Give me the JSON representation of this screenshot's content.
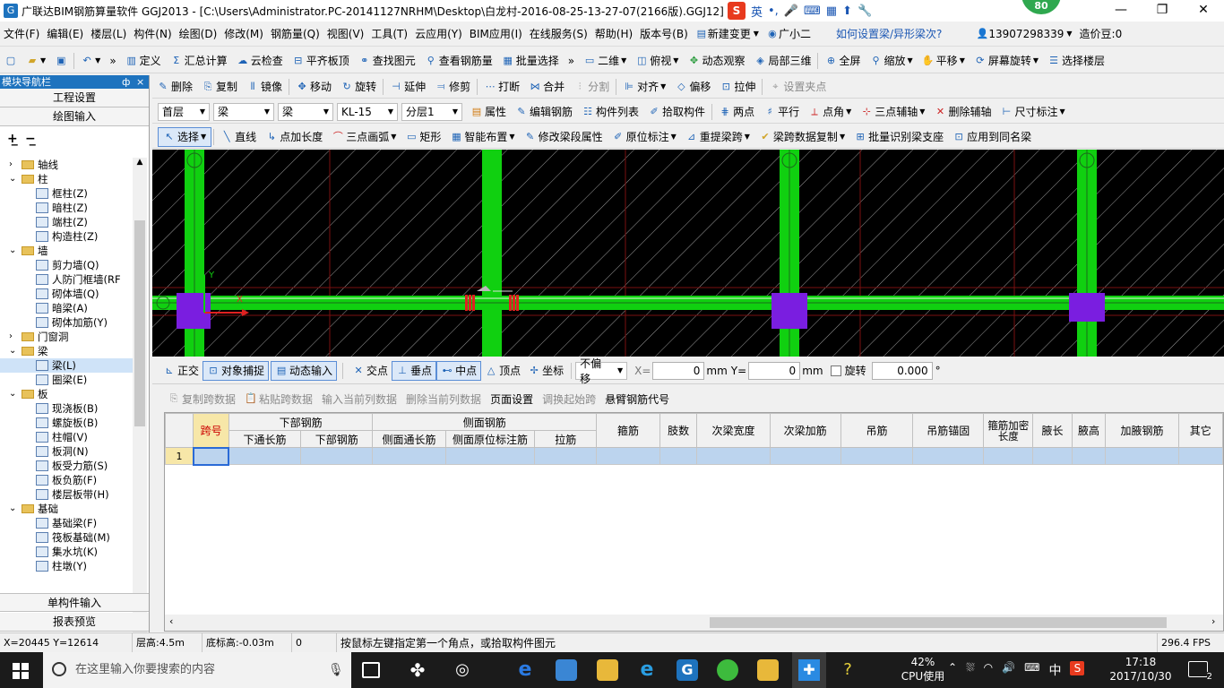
{
  "title_bar": {
    "title": "广联达BIM钢筋算量软件 GGJ2013 - [C:\\Users\\Administrator.PC-20141127NRHM\\Desktop\\白龙村-2016-08-25-13-27-07(2166版).GGJ12]",
    "ime_label": "英",
    "badge": "80",
    "minimize": "—",
    "maximize": "❐",
    "close": "✕"
  },
  "menu": {
    "items": [
      "文件(F)",
      "编辑(E)",
      "楼层(L)",
      "构件(N)",
      "绘图(D)",
      "修改(M)",
      "钢筋量(Q)",
      "视图(V)",
      "工具(T)",
      "云应用(Y)",
      "BIM应用(I)",
      "在线服务(S)",
      "帮助(H)",
      "版本号(B)"
    ],
    "new_change": "新建变更",
    "guangxiaoer": "广小二",
    "help_link": "如何设置梁/异形梁次?",
    "phone": "13907298339",
    "price": "造价豆:0"
  },
  "toolbar1": {
    "items": [
      "定义",
      "汇总计算",
      "云检查",
      "平齐板顶",
      "查找图元",
      "查看钢筋量",
      "批量选择"
    ],
    "view_mode": "二维",
    "items2": [
      "俯视",
      "动态观察",
      "局部三维",
      "全屏",
      "缩放",
      "平移",
      "屏幕旋转",
      "选择楼层"
    ]
  },
  "toolbar2": {
    "items": [
      "删除",
      "复制",
      "镜像",
      "移动",
      "旋转",
      "延伸",
      "修剪",
      "打断",
      "合并",
      "分割",
      "对齐",
      "偏移",
      "拉伸",
      "设置夹点"
    ]
  },
  "toolbar3": {
    "floor": "首层",
    "category": "梁",
    "type": "梁",
    "component": "KL-15",
    "layer": "分层1",
    "items": [
      "属性",
      "编辑钢筋",
      "构件列表",
      "拾取构件",
      "两点",
      "平行",
      "点角",
      "三点辅轴",
      "删除辅轴",
      "尺寸标注"
    ]
  },
  "toolbar4": {
    "items": [
      "选择",
      "直线",
      "点加长度",
      "三点画弧",
      "矩形",
      "智能布置",
      "修改梁段属性",
      "原位标注",
      "重提梁跨",
      "梁跨数据复制",
      "批量识别梁支座",
      "应用到同名梁"
    ]
  },
  "leftnav": {
    "header": "模块导航栏",
    "pin": "ф",
    "close": "×",
    "btn_project": "工程设置",
    "btn_draw": "绘图输入",
    "tree": [
      {
        "label": "轴线",
        "level": 0,
        "type": "folder",
        "exp": "›"
      },
      {
        "label": "柱",
        "level": 0,
        "type": "folder",
        "exp": "⌄"
      },
      {
        "label": "框柱(Z)",
        "level": 1,
        "type": "leaf"
      },
      {
        "label": "暗柱(Z)",
        "level": 1,
        "type": "leaf"
      },
      {
        "label": "端柱(Z)",
        "level": 1,
        "type": "leaf"
      },
      {
        "label": "构造柱(Z)",
        "level": 1,
        "type": "leaf"
      },
      {
        "label": "墙",
        "level": 0,
        "type": "folder",
        "exp": "⌄"
      },
      {
        "label": "剪力墙(Q)",
        "level": 1,
        "type": "leaf"
      },
      {
        "label": "人防门框墙(RF",
        "level": 1,
        "type": "leaf"
      },
      {
        "label": "砌体墙(Q)",
        "level": 1,
        "type": "leaf"
      },
      {
        "label": "暗梁(A)",
        "level": 1,
        "type": "leaf"
      },
      {
        "label": "砌体加筋(Y)",
        "level": 1,
        "type": "leaf"
      },
      {
        "label": "门窗洞",
        "level": 0,
        "type": "folder",
        "exp": "›"
      },
      {
        "label": "梁",
        "level": 0,
        "type": "folder",
        "exp": "⌄"
      },
      {
        "label": "梁(L)",
        "level": 1,
        "type": "leaf",
        "selected": true
      },
      {
        "label": "圈梁(E)",
        "level": 1,
        "type": "leaf"
      },
      {
        "label": "板",
        "level": 0,
        "type": "folder",
        "exp": "⌄"
      },
      {
        "label": "现浇板(B)",
        "level": 1,
        "type": "leaf"
      },
      {
        "label": "螺旋板(B)",
        "level": 1,
        "type": "leaf"
      },
      {
        "label": "柱帽(V)",
        "level": 1,
        "type": "leaf"
      },
      {
        "label": "板洞(N)",
        "level": 1,
        "type": "leaf"
      },
      {
        "label": "板受力筋(S)",
        "level": 1,
        "type": "leaf"
      },
      {
        "label": "板负筋(F)",
        "level": 1,
        "type": "leaf"
      },
      {
        "label": "楼层板带(H)",
        "level": 1,
        "type": "leaf"
      },
      {
        "label": "基础",
        "level": 0,
        "type": "folder",
        "exp": "⌄"
      },
      {
        "label": "基础梁(F)",
        "level": 1,
        "type": "leaf"
      },
      {
        "label": "筏板基础(M)",
        "level": 1,
        "type": "leaf"
      },
      {
        "label": "集水坑(K)",
        "level": 1,
        "type": "leaf"
      },
      {
        "label": "柱墩(Y)",
        "level": 1,
        "type": "leaf"
      }
    ],
    "btn_single": "单构件输入",
    "btn_report": "报表预览"
  },
  "snapbar": {
    "items": [
      "正交",
      "对象捕捉",
      "动态输入",
      "交点",
      "垂点",
      "中点",
      "顶点",
      "坐标"
    ],
    "offset_mode": "不偏移",
    "x_label": "X=",
    "x_value": "0",
    "mm": "mm",
    "y_label": "Y=",
    "y_value": "0",
    "rotate_label": "旋转",
    "rotate_value": "0.000",
    "degree": "°"
  },
  "gridtb": {
    "items": [
      "复制跨数据",
      "粘贴跨数据",
      "输入当前列数据",
      "删除当前列数据",
      "页面设置",
      "调换起始跨",
      "悬臂钢筋代号"
    ]
  },
  "table": {
    "group_headers": {
      "bottom": "下部钢筋",
      "side": "侧面钢筋"
    },
    "span_header": "跨号",
    "sub_headers": [
      "下通长筋",
      "下部钢筋",
      "侧面通长筋",
      "侧面原位标注筋",
      "拉筋"
    ],
    "single_headers": [
      "箍筋",
      "肢数",
      "次梁宽度",
      "次梁加筋",
      "吊筋",
      "吊筋锚固",
      "箍筋加密长度",
      "腋长",
      "腋高",
      "加腋钢筋",
      "其它"
    ],
    "rows": [
      {
        "num": "1"
      }
    ]
  },
  "status": {
    "coords": "X=20445 Y=12614",
    "floor_height": "层高:4.5m",
    "bottom_elev": "底标高:-0.03m",
    "zero": "0",
    "hint": "按鼠标左键指定第一个角点，或拾取构件图元",
    "fps": "296.4 FPS"
  },
  "taskbar": {
    "search_placeholder": "在这里输入你要搜索的内容",
    "cpu_percent": "42%",
    "cpu_label": "CPU使用",
    "lang": "中",
    "time": "17:18",
    "date": "2017/10/30",
    "notif_count": "2"
  }
}
